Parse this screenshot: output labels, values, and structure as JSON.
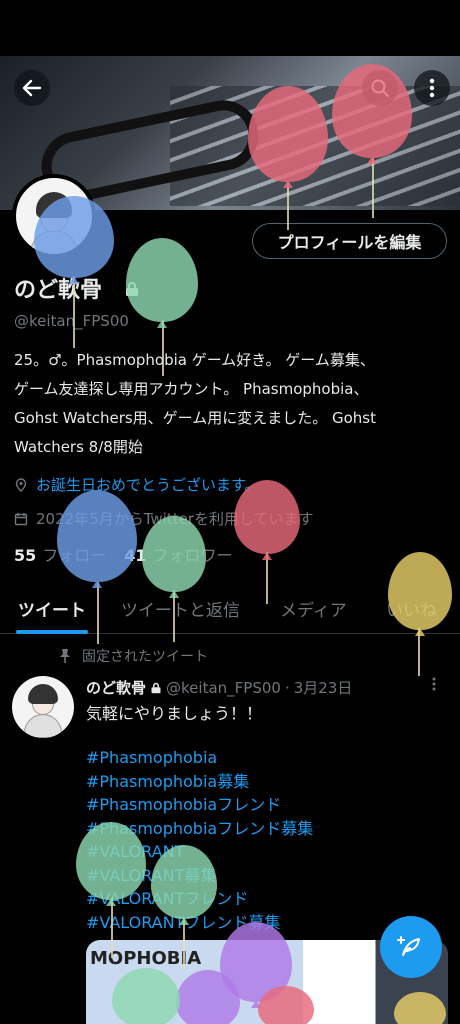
{
  "profile": {
    "display_name": "のど軟骨",
    "handle": "@keitan_FPS00",
    "bio": "25。♂。Phasmophobia ゲーム好き。 ゲーム募集、\nゲーム友達探し専用アカウント。 Phasmophobia、\nGohst Watchers用、ゲーム用に変えました。 Gohst\nWatchers 8/8開始",
    "birthday_text": "お誕生日おめでとうございます。",
    "joined_text": "2022年5月からTwitterを利用しています",
    "following_count": "55",
    "following_label": "フォロー",
    "followers_count": "41",
    "followers_label": "フォロワー",
    "edit_button": "プロフィールを編集"
  },
  "tabs": [
    {
      "label": "ツイート",
      "active": true
    },
    {
      "label": "ツイートと返信",
      "active": false
    },
    {
      "label": "メディア",
      "active": false
    },
    {
      "label": "いいね",
      "active": false
    }
  ],
  "pinned": {
    "label": "固定されたツイート",
    "tweet": {
      "name": "のど軟骨",
      "handle": "@keitan_FPS00",
      "separator": "·",
      "date": "3月23日",
      "text": "気軽にやりましょう！！",
      "hashtags": [
        "#Phasmophobia",
        " #Phasmophobia募集",
        " #Phasmophobiaフレンド",
        " #Phasmophobiaフレンド募集",
        "#VALORANT",
        "#VALORANT募集",
        "#VALORANTフレンド",
        "#VALORANTフレンド募集"
      ],
      "media_title": "MOPHOBIA"
    }
  },
  "icons": {
    "back": "back-arrow-icon",
    "search": "search-icon",
    "more": "more-vertical-icon",
    "lock": "lock-icon",
    "location": "location-icon",
    "calendar": "calendar-icon",
    "pin": "pin-icon",
    "compose": "compose-feather-icon"
  },
  "colors": {
    "accent": "#1d9bf0",
    "background": "#000000",
    "text": "#e7e9ea",
    "muted": "#71767b",
    "balloon_red": "#e8697b",
    "balloon_blue": "#6d9ee8",
    "balloon_green": "#8ed8b0",
    "balloon_yellow": "#e8d06a",
    "balloon_purple": "#b07be8"
  }
}
